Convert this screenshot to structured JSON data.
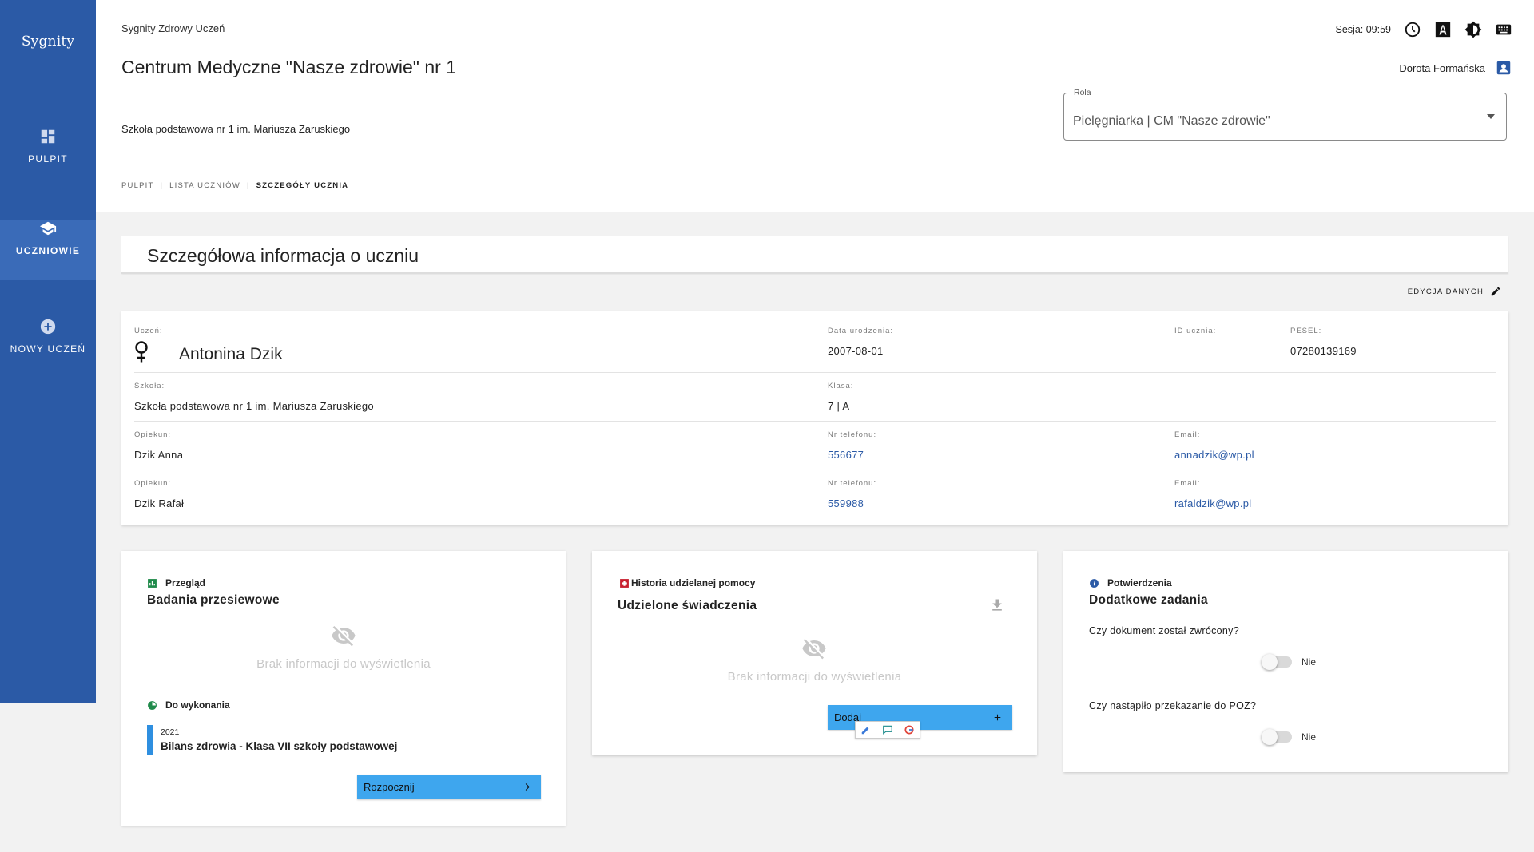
{
  "sidebar": {
    "logo": "Sygnity",
    "items": [
      {
        "label": "PULPIT",
        "icon": "dashboard-icon"
      },
      {
        "label": "UCZNIOWIE",
        "icon": "school-icon",
        "active": true
      },
      {
        "label": "NOWY UCZEŃ",
        "icon": "add-circle-icon"
      }
    ]
  },
  "header": {
    "app_name": "Sygnity Zdrowy Uczeń",
    "title": "Centrum Medyczne \"Nasze zdrowie\" nr 1",
    "school": "Szkoła podstawowa nr 1 im. Mariusza Zaruskiego",
    "session": "Sesja: 09:59",
    "user": "Dorota Formańska",
    "role": {
      "label": "Rola",
      "value": "Pielęgniarka | CM \"Nasze zdrowie\""
    },
    "breadcrumb": [
      "PULPIT",
      "LISTA UCZNIÓW",
      "SZCZEGÓŁY UCZNIA"
    ]
  },
  "section_title": "Szczegółowa informacja o uczniu",
  "edit_label": "EDYCJA DANYCH",
  "student": {
    "labels": {
      "student": "Uczeń:",
      "birth": "Data urodzenia:",
      "id": "ID ucznia:",
      "pesel": "PESEL:",
      "school": "Szkoła:",
      "class": "Klasa:",
      "guardian": "Opiekun:",
      "phone": "Nr telefonu:",
      "email": "Email:"
    },
    "name": "Antonina Dzik",
    "birth_date": "2007-08-01",
    "id": "",
    "pesel": "07280139169",
    "school": "Szkoła podstawowa nr 1 im. Mariusza Zaruskiego",
    "class": "7 | A",
    "guardians": [
      {
        "name": "Dzik Anna",
        "phone": "556677",
        "email": "annadzik@wp.pl"
      },
      {
        "name": "Dzik Rafał",
        "phone": "559988",
        "email": "rafaldzik@wp.pl"
      }
    ]
  },
  "overview_card": {
    "head": "Przegląd",
    "title": "Badania przesiewowe",
    "empty": "Brak informacji do wyświetlenia",
    "todo_head": "Do wykonania",
    "task_year": "2021",
    "task_name": "Bilans zdrowia - Klasa VII szkoły podstawowej",
    "button": "Rozpocznij"
  },
  "history_card": {
    "head": "Historia udzielanej pomocy",
    "title": "Udzielone świadczenia",
    "empty": "Brak informacji do wyświetlenia",
    "button": "Dodaj"
  },
  "confirm_card": {
    "head": "Potwierdzenia",
    "title": "Dodatkowe zadania",
    "q1": "Czy dokument został zwrócony?",
    "q1_value": "Nie",
    "q2": "Czy nastąpiło przekazanie do POZ?",
    "q2_value": "Nie"
  },
  "colors": {
    "sidebar": "#2b5aa6",
    "accent": "#3ea6ee",
    "link": "#2b5aa6",
    "task_bar": "#2f8fe0"
  }
}
